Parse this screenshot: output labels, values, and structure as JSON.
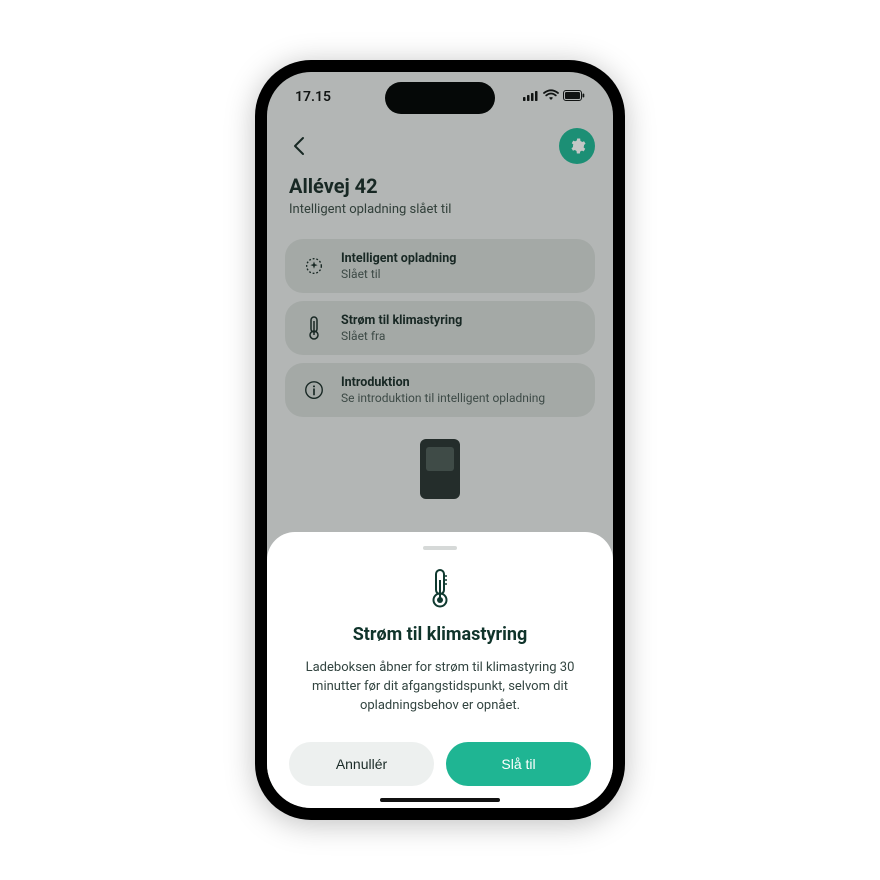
{
  "status_bar": {
    "time": "17.15"
  },
  "header": {
    "title": "Allévej 42",
    "subtitle": "Intelligent opladning slået til"
  },
  "cards": [
    {
      "title": "Intelligent opladning",
      "subtitle": "Slået til",
      "icon": "sparkle-icon"
    },
    {
      "title": "Strøm til klimastyring",
      "subtitle": "Slået fra",
      "icon": "thermometer-icon"
    },
    {
      "title": "Introduktion",
      "subtitle": "Se introduktion til intelligent opladning",
      "icon": "info-icon"
    }
  ],
  "sheet": {
    "title": "Strøm til klimastyring",
    "body": "Ladeboksen åbner for strøm til klimastyring 30 minutter før dit afgangstidspunkt, selvom dit opladningsbehov er opnået.",
    "cancel_label": "Annullér",
    "confirm_label": "Slå til"
  },
  "colors": {
    "accent": "#1fb593"
  }
}
